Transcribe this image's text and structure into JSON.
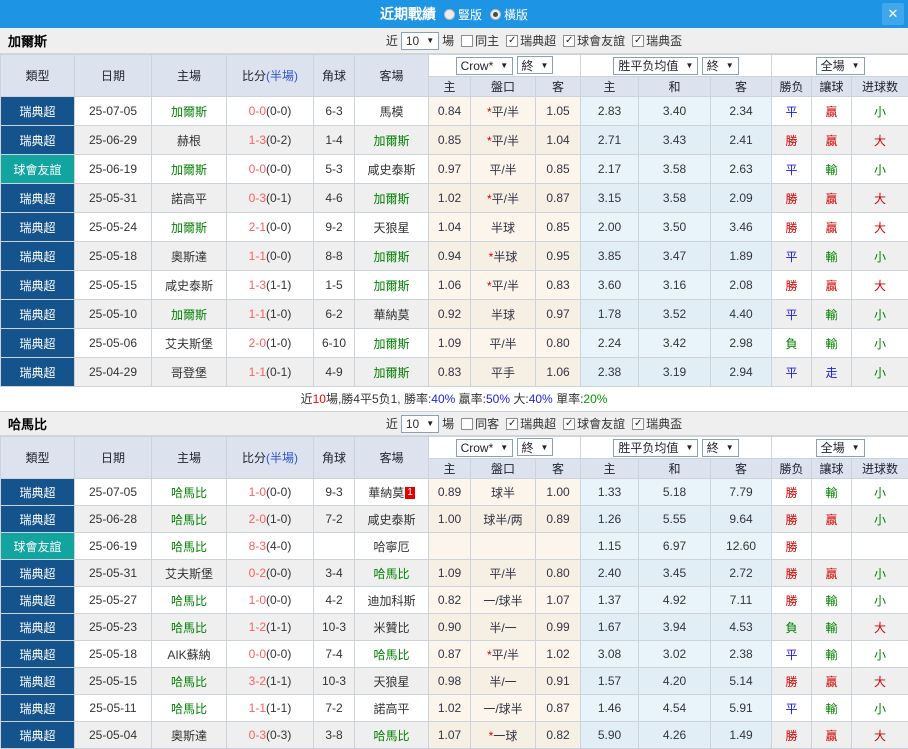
{
  "titlebar": {
    "title": "近期戰績",
    "vertical": "豎版",
    "horizontal": "橫版",
    "close": "✕"
  },
  "labels": {
    "near": "近",
    "count": "10",
    "games": "場",
    "comps": [
      "瑞典超",
      "球會友誼",
      "瑞典盃"
    ]
  },
  "dropdowns": {
    "bookmaker": "Crow*",
    "final1": "終",
    "avg": "胜平负均值",
    "final2": "終",
    "scope": "全場"
  },
  "columns": {
    "type": "類型",
    "date": "日期",
    "home": "主場",
    "score_main": "比分",
    "score_half": "(半場)",
    "corner": "角球",
    "away": "客場",
    "h": "主",
    "handicap": "盤口",
    "a": "客",
    "avg_h": "主",
    "avg_d": "和",
    "avg_a": "客",
    "result": "勝负",
    "handicap_result": "讓球",
    "goals": "进球数"
  },
  "tables": [
    {
      "team": "加爾斯",
      "same_label": "同主",
      "rows": [
        {
          "type": "瑞典超",
          "type_cls": "",
          "date": "25-07-05",
          "home": "加爾斯",
          "home_cls": "focus",
          "ft": "0-0",
          "ht": "(0-0)",
          "corner": "6-3",
          "away": "馬模",
          "away_cls": "",
          "badge": "",
          "crown_h": "0.84",
          "star": "*",
          "handicap": "平/半",
          "crown_a": "1.05",
          "avg_h": "2.83",
          "avg_d": "3.40",
          "avg_a": "2.34",
          "res": "平",
          "res_cls": "blue",
          "hres": "贏",
          "hres_cls": "red",
          "goal": "小",
          "goal_cls": "green"
        },
        {
          "type": "瑞典超",
          "type_cls": "",
          "date": "25-06-29",
          "home": "赫根",
          "home_cls": "",
          "ft": "1-3",
          "ht": "(0-2)",
          "corner": "1-4",
          "away": "加爾斯",
          "away_cls": "focus",
          "badge": "",
          "crown_h": "0.85",
          "star": "*",
          "handicap": "平/半",
          "crown_a": "1.04",
          "avg_h": "2.71",
          "avg_d": "3.43",
          "avg_a": "2.41",
          "res": "勝",
          "res_cls": "red",
          "hres": "贏",
          "hres_cls": "red",
          "goal": "大",
          "goal_cls": "red"
        },
        {
          "type": "球會友誼",
          "type_cls": "friendly",
          "date": "25-06-19",
          "home": "加爾斯",
          "home_cls": "focus",
          "ft": "0-0",
          "ht": "(0-0)",
          "corner": "5-3",
          "away": "咸史泰斯",
          "away_cls": "",
          "badge": "",
          "crown_h": "0.97",
          "star": "",
          "handicap": "平/半",
          "crown_a": "0.85",
          "avg_h": "2.17",
          "avg_d": "3.58",
          "avg_a": "2.63",
          "res": "平",
          "res_cls": "blue",
          "hres": "輸",
          "hres_cls": "green",
          "goal": "小",
          "goal_cls": "green"
        },
        {
          "type": "瑞典超",
          "type_cls": "",
          "date": "25-05-31",
          "home": "諾高平",
          "home_cls": "",
          "ft": "0-3",
          "ht": "(0-1)",
          "corner": "4-6",
          "away": "加爾斯",
          "away_cls": "focus",
          "badge": "",
          "crown_h": "1.02",
          "star": "*",
          "handicap": "平/半",
          "crown_a": "0.87",
          "avg_h": "3.15",
          "avg_d": "3.58",
          "avg_a": "2.09",
          "res": "勝",
          "res_cls": "red",
          "hres": "贏",
          "hres_cls": "red",
          "goal": "大",
          "goal_cls": "red"
        },
        {
          "type": "瑞典超",
          "type_cls": "",
          "date": "25-05-24",
          "home": "加爾斯",
          "home_cls": "focus",
          "ft": "2-1",
          "ht": "(0-0)",
          "corner": "9-2",
          "away": "天狼星",
          "away_cls": "",
          "badge": "",
          "crown_h": "1.04",
          "star": "",
          "handicap": "半球",
          "crown_a": "0.85",
          "avg_h": "2.00",
          "avg_d": "3.50",
          "avg_a": "3.46",
          "res": "勝",
          "res_cls": "red",
          "hres": "贏",
          "hres_cls": "red",
          "goal": "大",
          "goal_cls": "red"
        },
        {
          "type": "瑞典超",
          "type_cls": "",
          "date": "25-05-18",
          "home": "奧斯達",
          "home_cls": "",
          "ft": "1-1",
          "ht": "(0-0)",
          "corner": "8-8",
          "away": "加爾斯",
          "away_cls": "focus",
          "badge": "",
          "crown_h": "0.94",
          "star": "*",
          "handicap": "半球",
          "crown_a": "0.95",
          "avg_h": "3.85",
          "avg_d": "3.47",
          "avg_a": "1.89",
          "res": "平",
          "res_cls": "blue",
          "hres": "輸",
          "hres_cls": "green",
          "goal": "小",
          "goal_cls": "green"
        },
        {
          "type": "瑞典超",
          "type_cls": "",
          "date": "25-05-15",
          "home": "咸史泰斯",
          "home_cls": "",
          "ft": "1-3",
          "ht": "(1-1)",
          "corner": "1-5",
          "away": "加爾斯",
          "away_cls": "focus",
          "badge": "",
          "crown_h": "1.06",
          "star": "*",
          "handicap": "平/半",
          "crown_a": "0.83",
          "avg_h": "3.60",
          "avg_d": "3.16",
          "avg_a": "2.08",
          "res": "勝",
          "res_cls": "red",
          "hres": "贏",
          "hres_cls": "red",
          "goal": "大",
          "goal_cls": "red"
        },
        {
          "type": "瑞典超",
          "type_cls": "",
          "date": "25-05-10",
          "home": "加爾斯",
          "home_cls": "focus",
          "ft": "1-1",
          "ht": "(1-0)",
          "corner": "6-2",
          "away": "華納莫",
          "away_cls": "",
          "badge": "",
          "crown_h": "0.92",
          "star": "",
          "handicap": "半球",
          "crown_a": "0.97",
          "avg_h": "1.78",
          "avg_d": "3.52",
          "avg_a": "4.40",
          "res": "平",
          "res_cls": "blue",
          "hres": "輸",
          "hres_cls": "green",
          "goal": "小",
          "goal_cls": "green"
        },
        {
          "type": "瑞典超",
          "type_cls": "",
          "date": "25-05-06",
          "home": "艾夫斯堡",
          "home_cls": "",
          "ft": "2-0",
          "ht": "(1-0)",
          "corner": "6-10",
          "away": "加爾斯",
          "away_cls": "focus",
          "badge": "",
          "crown_h": "1.09",
          "star": "",
          "handicap": "平/半",
          "crown_a": "0.80",
          "avg_h": "2.24",
          "avg_d": "3.42",
          "avg_a": "2.98",
          "res": "負",
          "res_cls": "green",
          "hres": "輸",
          "hres_cls": "green",
          "goal": "小",
          "goal_cls": "green"
        },
        {
          "type": "瑞典超",
          "type_cls": "",
          "date": "25-04-29",
          "home": "哥登堡",
          "home_cls": "",
          "ft": "1-1",
          "ht": "(0-1)",
          "corner": "4-9",
          "away": "加爾斯",
          "away_cls": "focus",
          "badge": "",
          "crown_h": "0.83",
          "star": "",
          "handicap": "平手",
          "crown_a": "1.06",
          "avg_h": "2.38",
          "avg_d": "3.19",
          "avg_a": "2.94",
          "res": "平",
          "res_cls": "blue",
          "hres": "走",
          "hres_cls": "blue",
          "goal": "小",
          "goal_cls": "green"
        }
      ],
      "summary": [
        {
          "text": "近",
          "color": "#333333"
        },
        {
          "text": "10",
          "color": "#FF0000"
        },
        {
          "text": "場,勝4平5负1, 勝率:",
          "color": "#333333"
        },
        {
          "text": "40%",
          "color": "#2222DD"
        },
        {
          "text": " 贏率:",
          "color": "#333333"
        },
        {
          "text": "50%",
          "color": "#2222DD"
        },
        {
          "text": " 大:",
          "color": "#333333"
        },
        {
          "text": "40%",
          "color": "#2222DD"
        },
        {
          "text": " 單率:",
          "color": "#333333"
        },
        {
          "text": "20%",
          "color": "#009900"
        }
      ]
    },
    {
      "team": "哈馬比",
      "same_label": "同客",
      "rows": [
        {
          "type": "瑞典超",
          "type_cls": "",
          "date": "25-07-05",
          "home": "哈馬比",
          "home_cls": "focus",
          "ft": "1-0",
          "ht": "(0-0)",
          "corner": "9-3",
          "away": "華納莫",
          "away_cls": "",
          "badge": "1",
          "crown_h": "0.89",
          "star": "",
          "handicap": "球半",
          "crown_a": "1.00",
          "avg_h": "1.33",
          "avg_d": "5.18",
          "avg_a": "7.79",
          "res": "勝",
          "res_cls": "red",
          "hres": "輸",
          "hres_cls": "green",
          "goal": "小",
          "goal_cls": "green"
        },
        {
          "type": "瑞典超",
          "type_cls": "",
          "date": "25-06-28",
          "home": "哈馬比",
          "home_cls": "focus",
          "ft": "2-0",
          "ht": "(1-0)",
          "corner": "7-2",
          "away": "咸史泰斯",
          "away_cls": "",
          "badge": "",
          "crown_h": "1.00",
          "star": "",
          "handicap": "球半/两",
          "crown_a": "0.89",
          "avg_h": "1.26",
          "avg_d": "5.55",
          "avg_a": "9.64",
          "res": "勝",
          "res_cls": "red",
          "hres": "贏",
          "hres_cls": "red",
          "goal": "小",
          "goal_cls": "green"
        },
        {
          "type": "球會友誼",
          "type_cls": "friendly",
          "date": "25-06-19",
          "home": "哈馬比",
          "home_cls": "focus",
          "ft": "8-3",
          "ht": "(4-0)",
          "corner": "",
          "away": "哈寧厄",
          "away_cls": "",
          "badge": "",
          "crown_h": "",
          "star": "",
          "handicap": "",
          "crown_a": "",
          "avg_h": "1.15",
          "avg_d": "6.97",
          "avg_a": "12.60",
          "res": "勝",
          "res_cls": "red",
          "hres": "",
          "hres_cls": "",
          "goal": "",
          "goal_cls": ""
        },
        {
          "type": "瑞典超",
          "type_cls": "",
          "date": "25-05-31",
          "home": "艾夫斯堡",
          "home_cls": "",
          "ft": "0-2",
          "ht": "(0-0)",
          "corner": "3-4",
          "away": "哈馬比",
          "away_cls": "focus",
          "badge": "",
          "crown_h": "1.09",
          "star": "",
          "handicap": "平/半",
          "crown_a": "0.80",
          "avg_h": "2.40",
          "avg_d": "3.45",
          "avg_a": "2.72",
          "res": "勝",
          "res_cls": "red",
          "hres": "贏",
          "hres_cls": "red",
          "goal": "小",
          "goal_cls": "green"
        },
        {
          "type": "瑞典超",
          "type_cls": "",
          "date": "25-05-27",
          "home": "哈馬比",
          "home_cls": "focus",
          "ft": "1-0",
          "ht": "(0-0)",
          "corner": "4-2",
          "away": "迪加科斯",
          "away_cls": "",
          "badge": "",
          "crown_h": "0.82",
          "star": "",
          "handicap": "一/球半",
          "crown_a": "1.07",
          "avg_h": "1.37",
          "avg_d": "4.92",
          "avg_a": "7.11",
          "res": "勝",
          "res_cls": "red",
          "hres": "輸",
          "hres_cls": "green",
          "goal": "小",
          "goal_cls": "green"
        },
        {
          "type": "瑞典超",
          "type_cls": "",
          "date": "25-05-23",
          "home": "哈馬比",
          "home_cls": "focus",
          "ft": "1-2",
          "ht": "(1-1)",
          "corner": "10-3",
          "away": "米贊比",
          "away_cls": "",
          "badge": "",
          "crown_h": "0.90",
          "star": "",
          "handicap": "半/一",
          "crown_a": "0.99",
          "avg_h": "1.67",
          "avg_d": "3.94",
          "avg_a": "4.53",
          "res": "負",
          "res_cls": "green",
          "hres": "輸",
          "hres_cls": "green",
          "goal": "大",
          "goal_cls": "red"
        },
        {
          "type": "瑞典超",
          "type_cls": "",
          "date": "25-05-18",
          "home": "AIK蘇納",
          "home_cls": "",
          "ft": "0-0",
          "ht": "(0-0)",
          "corner": "7-4",
          "away": "哈馬比",
          "away_cls": "focus",
          "badge": "",
          "crown_h": "0.87",
          "star": "*",
          "handicap": "平/半",
          "crown_a": "1.02",
          "avg_h": "3.08",
          "avg_d": "3.02",
          "avg_a": "2.38",
          "res": "平",
          "res_cls": "blue",
          "hres": "輸",
          "hres_cls": "green",
          "goal": "小",
          "goal_cls": "green"
        },
        {
          "type": "瑞典超",
          "type_cls": "",
          "date": "25-05-15",
          "home": "哈馬比",
          "home_cls": "focus",
          "ft": "3-2",
          "ht": "(1-1)",
          "corner": "10-3",
          "away": "天狼星",
          "away_cls": "",
          "badge": "",
          "crown_h": "0.98",
          "star": "",
          "handicap": "半/一",
          "crown_a": "0.91",
          "avg_h": "1.57",
          "avg_d": "4.20",
          "avg_a": "5.14",
          "res": "勝",
          "res_cls": "red",
          "hres": "贏",
          "hres_cls": "red",
          "goal": "大",
          "goal_cls": "red"
        },
        {
          "type": "瑞典超",
          "type_cls": "",
          "date": "25-05-11",
          "home": "哈馬比",
          "home_cls": "focus",
          "ft": "1-1",
          "ht": "(1-1)",
          "corner": "7-2",
          "away": "諾高平",
          "away_cls": "",
          "badge": "",
          "crown_h": "1.02",
          "star": "",
          "handicap": "一/球半",
          "crown_a": "0.87",
          "avg_h": "1.46",
          "avg_d": "4.54",
          "avg_a": "5.91",
          "res": "平",
          "res_cls": "blue",
          "hres": "輸",
          "hres_cls": "green",
          "goal": "小",
          "goal_cls": "green"
        },
        {
          "type": "瑞典超",
          "type_cls": "",
          "date": "25-05-04",
          "home": "奧斯達",
          "home_cls": "",
          "ft": "0-3",
          "ht": "(0-3)",
          "corner": "3-8",
          "away": "哈馬比",
          "away_cls": "focus",
          "badge": "",
          "crown_h": "1.07",
          "star": "*",
          "handicap": "一球",
          "crown_a": "0.82",
          "avg_h": "5.90",
          "avg_d": "4.26",
          "avg_a": "1.49",
          "res": "勝",
          "res_cls": "red",
          "hres": "贏",
          "hres_cls": "red",
          "goal": "大",
          "goal_cls": "red"
        }
      ]
    }
  ]
}
